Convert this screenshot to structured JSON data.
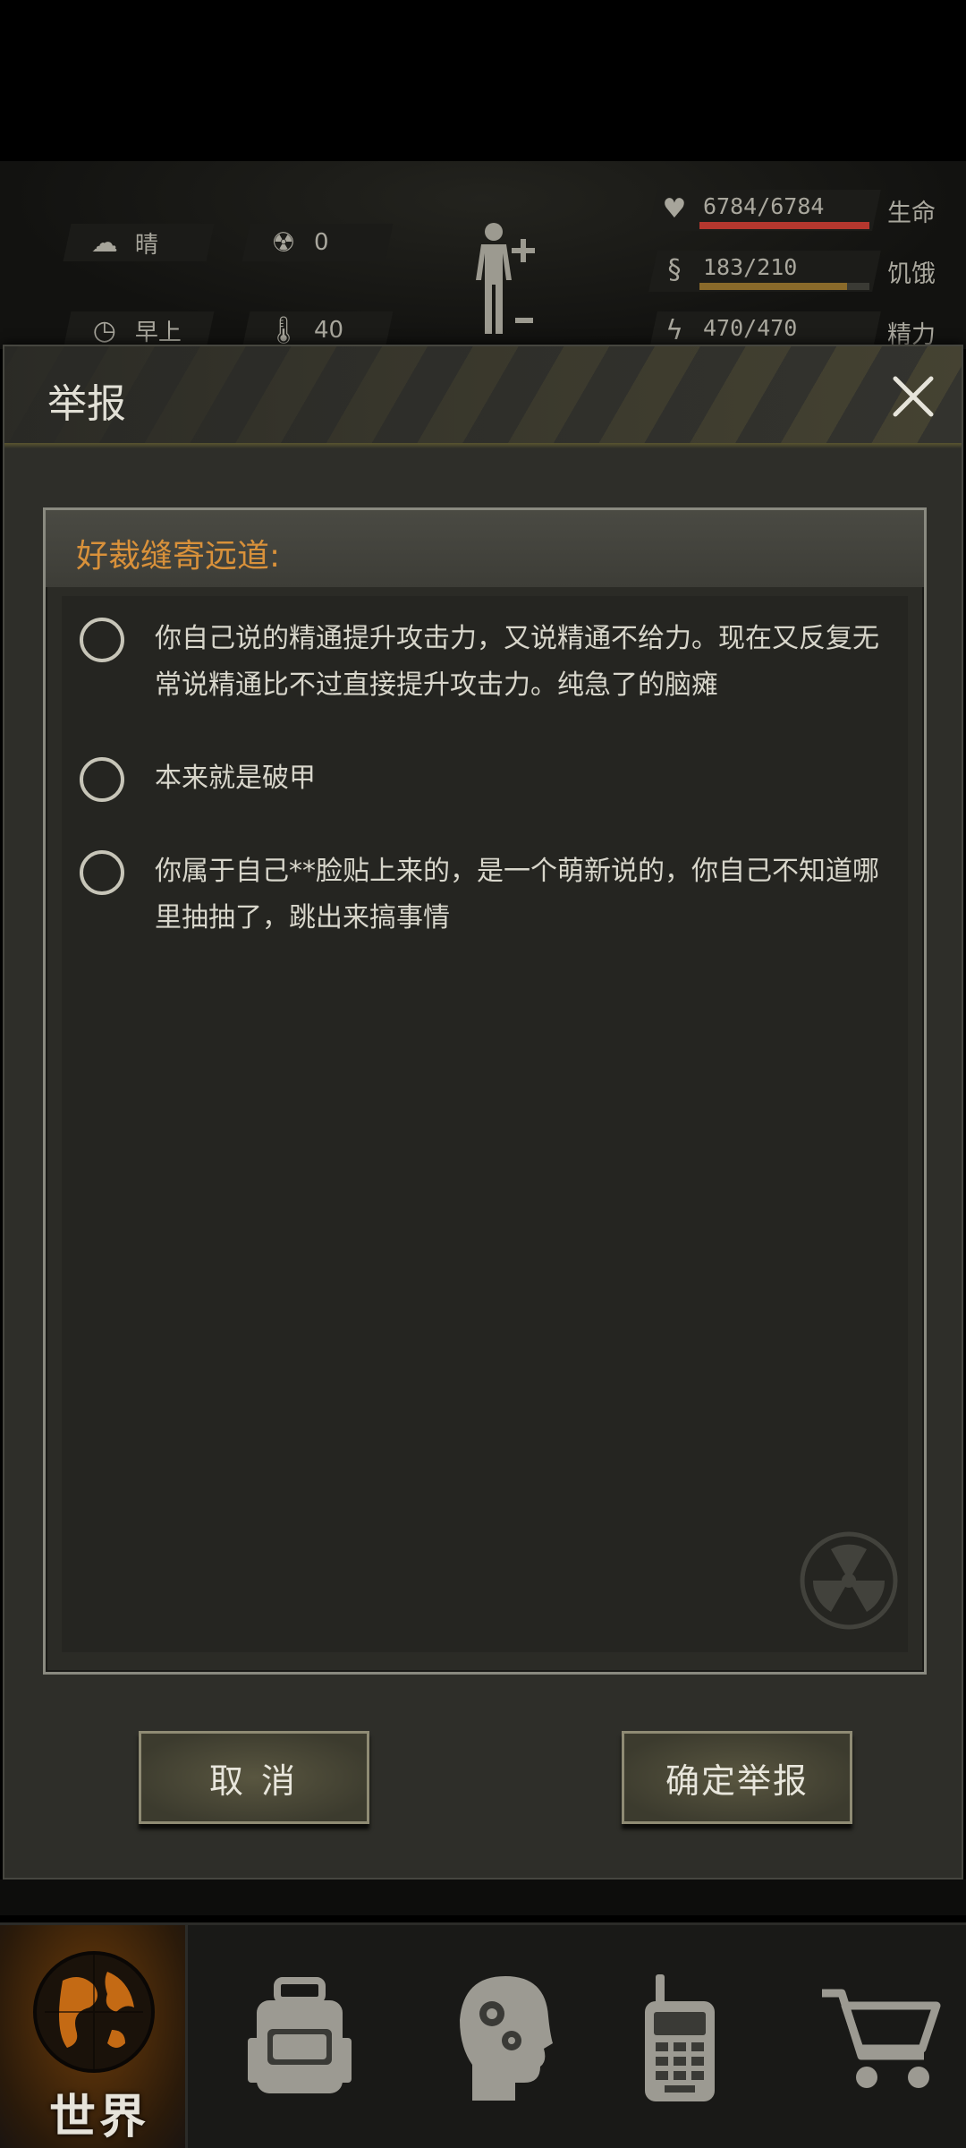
{
  "hud": {
    "weather": "晴",
    "radiation": "0",
    "time_of_day": "早上",
    "temperature": "40",
    "stats": [
      {
        "value": "6784/6784",
        "label": "生命",
        "icon": "heart-pulse-icon",
        "fill_fraction": 1.0,
        "color": "#b5372e"
      },
      {
        "value": "183/210",
        "label": "饥饿",
        "icon": "stomach-icon",
        "fill_fraction": 0.87,
        "color": "#8a6a2a"
      },
      {
        "value": "470/470",
        "label": "精力",
        "icon": "energy-icon",
        "fill_fraction": 1.0,
        "color": "#6a6a5e"
      }
    ]
  },
  "dialog": {
    "title": "举报",
    "target_name": "好裁缝寄远道:",
    "options": [
      "你自己说的精通提升攻击力，又说精通不给力。现在又反复无常说精通比不过直接提升攻击力。纯急了的脑瘫",
      "本来就是破甲",
      "你属于自己**脸贴上来的，是一个萌新说的，你自己不知道哪里抽抽了，跳出来搞事情"
    ],
    "cancel_label": "取 消",
    "confirm_label": "确定举报"
  },
  "nav": {
    "world_label": "世界",
    "accent_color": "#d9913a"
  }
}
